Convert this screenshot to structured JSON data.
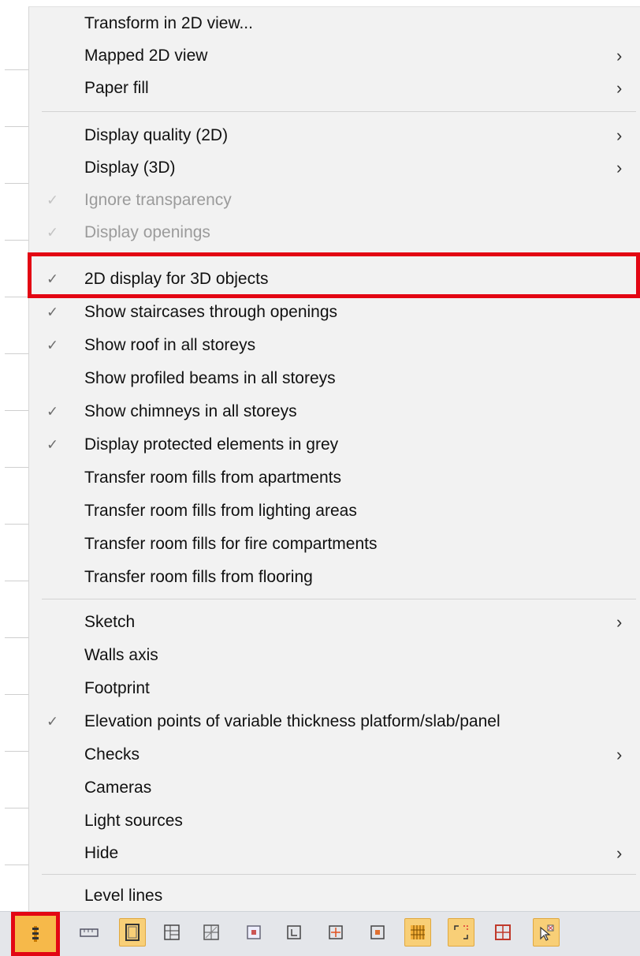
{
  "menu": {
    "items": [
      {
        "label": "Transform in 2D view...",
        "checked": false,
        "disabled": false,
        "submenu": false
      },
      {
        "label": "Mapped 2D view",
        "checked": false,
        "disabled": false,
        "submenu": true
      },
      {
        "label": "Paper fill",
        "checked": false,
        "disabled": false,
        "submenu": true
      },
      {
        "label": "Display quality (2D)",
        "checked": false,
        "disabled": false,
        "submenu": true
      },
      {
        "label": "Display (3D)",
        "checked": false,
        "disabled": false,
        "submenu": true
      },
      {
        "label": "Ignore transparency",
        "checked": true,
        "disabled": true,
        "submenu": false
      },
      {
        "label": "Display openings",
        "checked": true,
        "disabled": true,
        "submenu": false
      },
      {
        "label": "2D display for 3D objects",
        "checked": true,
        "disabled": false,
        "submenu": false
      },
      {
        "label": "Show staircases through openings",
        "checked": true,
        "disabled": false,
        "submenu": false
      },
      {
        "label": "Show roof in all storeys",
        "checked": true,
        "disabled": false,
        "submenu": false
      },
      {
        "label": "Show profiled beams in all storeys",
        "checked": false,
        "disabled": false,
        "submenu": false
      },
      {
        "label": "Show chimneys in all storeys",
        "checked": true,
        "disabled": false,
        "submenu": false
      },
      {
        "label": "Display protected elements in grey",
        "checked": true,
        "disabled": false,
        "submenu": false
      },
      {
        "label": "Transfer room fills from apartments",
        "checked": false,
        "disabled": false,
        "submenu": false
      },
      {
        "label": "Transfer room fills from lighting areas",
        "checked": false,
        "disabled": false,
        "submenu": false
      },
      {
        "label": "Transfer room fills for fire compartments",
        "checked": false,
        "disabled": false,
        "submenu": false
      },
      {
        "label": "Transfer room fills from flooring",
        "checked": false,
        "disabled": false,
        "submenu": false
      },
      {
        "label": "Sketch",
        "checked": false,
        "disabled": false,
        "submenu": true
      },
      {
        "label": "Walls axis",
        "checked": false,
        "disabled": false,
        "submenu": false
      },
      {
        "label": "Footprint",
        "checked": false,
        "disabled": false,
        "submenu": false
      },
      {
        "label": "Elevation points of variable thickness platform/slab/panel",
        "checked": true,
        "disabled": false,
        "submenu": false
      },
      {
        "label": "Checks",
        "checked": false,
        "disabled": false,
        "submenu": true
      },
      {
        "label": "Cameras",
        "checked": false,
        "disabled": false,
        "submenu": false
      },
      {
        "label": "Light sources",
        "checked": false,
        "disabled": false,
        "submenu": false
      },
      {
        "label": "Hide",
        "checked": false,
        "disabled": false,
        "submenu": true
      },
      {
        "label": "Level lines",
        "checked": false,
        "disabled": false,
        "submenu": false
      }
    ],
    "check_glyph": "✓",
    "arrow_glyph": "›"
  },
  "toolbar": {
    "buttons": [
      {
        "icon": "display-options-icon",
        "active": true
      },
      {
        "icon": "ruler-icon",
        "active": false
      },
      {
        "icon": "frame-icon",
        "active": true
      },
      {
        "icon": "grid-layout-icon",
        "active": false
      },
      {
        "icon": "hatched-grid-icon",
        "active": false
      },
      {
        "icon": "image-fill-icon",
        "active": false
      },
      {
        "icon": "corner-marker-icon",
        "active": false
      },
      {
        "icon": "center-point-icon",
        "active": false
      },
      {
        "icon": "target-icon",
        "active": false
      },
      {
        "icon": "hatch-pattern-icon",
        "active": true
      },
      {
        "icon": "dashed-corners-icon",
        "active": true
      },
      {
        "icon": "window-split-icon",
        "active": false
      },
      {
        "icon": "select-cursor-icon",
        "active": true
      }
    ]
  },
  "colors": {
    "menu_bg": "#f2f2f2",
    "highlight_red": "#e30613",
    "toolbar_active": "#f8cf77",
    "disabled_text": "#9b9b9b"
  }
}
